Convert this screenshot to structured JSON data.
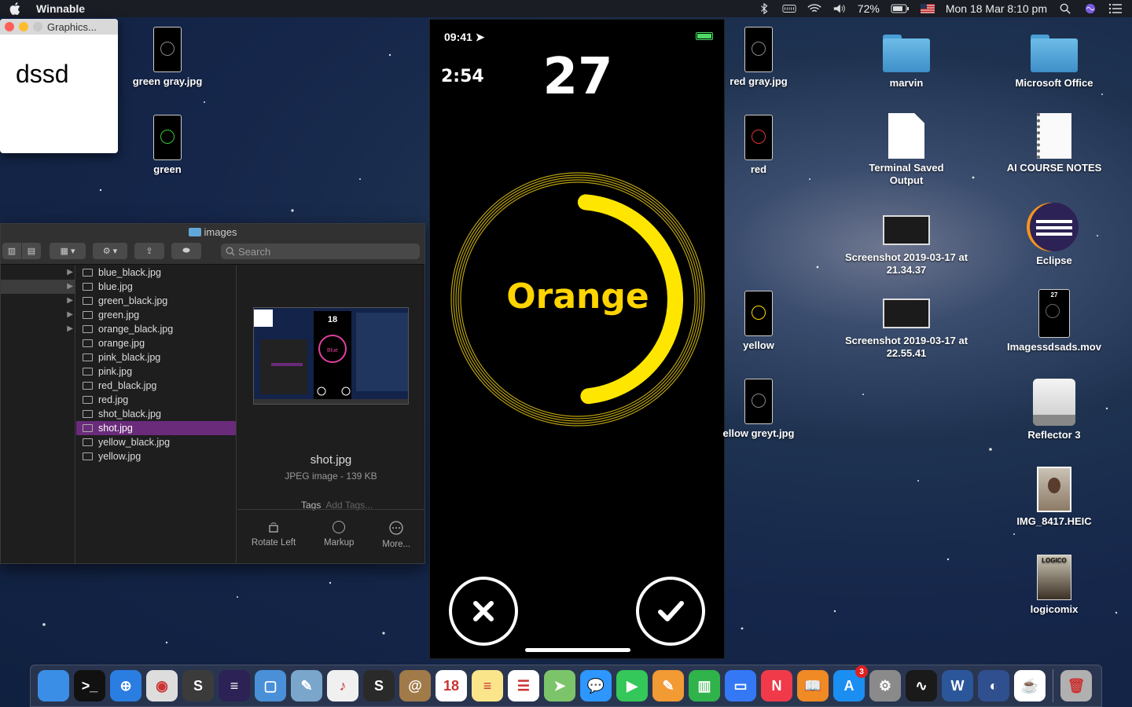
{
  "menubar": {
    "app_name": "Winnable",
    "battery_percent": "72%",
    "datetime": "Mon 18 Mar  8:10 pm"
  },
  "graphics_window": {
    "title": "Graphics...",
    "content_text": "dssd"
  },
  "finder": {
    "title": "images",
    "search_placeholder": "Search",
    "files": [
      {
        "name": "blue_black.jpg",
        "selected": false
      },
      {
        "name": "blue.jpg",
        "selected": false
      },
      {
        "name": "green_black.jpg",
        "selected": false
      },
      {
        "name": "green.jpg",
        "selected": false
      },
      {
        "name": "orange_black.jpg",
        "selected": false
      },
      {
        "name": "orange.jpg",
        "selected": false
      },
      {
        "name": "pink_black.jpg",
        "selected": false
      },
      {
        "name": "pink.jpg",
        "selected": false
      },
      {
        "name": "red_black.jpg",
        "selected": false
      },
      {
        "name": "red.jpg",
        "selected": false
      },
      {
        "name": "shot_black.jpg",
        "selected": false
      },
      {
        "name": "shot.jpg",
        "selected": true
      },
      {
        "name": "yellow_black.jpg",
        "selected": false
      },
      {
        "name": "yellow.jpg",
        "selected": false
      }
    ],
    "preview": {
      "file_name": "shot.jpg",
      "file_info": "JPEG image - 139 KB",
      "tags_label": "Tags",
      "tags_placeholder": "Add Tags...",
      "actions": {
        "rotate": "Rotate Left",
        "markup": "Markup",
        "more": "More..."
      },
      "thumb_score": "18",
      "thumb_word": "Blue"
    }
  },
  "phone": {
    "clock": "09:41",
    "timer": "2:54",
    "score": "27",
    "word": "Orange",
    "word_color": "#ffd400",
    "ring_progress": 0.47,
    "ring_color": "#ffe600"
  },
  "desktop": {
    "col_left": [
      {
        "label": "green gray.jpg",
        "ring": "#888"
      },
      {
        "label": "green",
        "ring": "#3c3"
      }
    ],
    "col_mid": [
      {
        "label": "red gray.jpg",
        "ring": "#888"
      },
      {
        "label": "red",
        "ring": "#d33"
      },
      {
        "label": "yellow",
        "ring": "#fd0"
      },
      {
        "label": "ellow greyt.jpg",
        "ring": "#888"
      }
    ],
    "col_c": {
      "marvin": "marvin",
      "terminal": "Terminal Saved Output",
      "ss1": "Screenshot 2019-03-17 at 21.34.37",
      "ss2": "Screenshot 2019-03-17 at 22.55.41"
    },
    "col_d": {
      "office": "Microsoft Office",
      "ai": "AI COURSE NOTES",
      "eclipse": "Eclipse",
      "mov": "Imagessdsads.mov",
      "reflector": "Reflector 3",
      "img": "IMG_8417.HEIC",
      "logicomix": "logicomix",
      "mov_score": "27",
      "book_title": "LOGICO"
    }
  },
  "dock": {
    "apps": [
      {
        "name": "finder",
        "color": "#3a8ee6",
        "glyph": ""
      },
      {
        "name": "terminal",
        "color": "#111",
        "glyph": ">_"
      },
      {
        "name": "safari",
        "color": "#2a7de1",
        "glyph": "⊕"
      },
      {
        "name": "chrome",
        "color": "#ddd",
        "glyph": "◉"
      },
      {
        "name": "sublime",
        "color": "#3b3b3b",
        "glyph": "S"
      },
      {
        "name": "eclipse",
        "color": "#2c2255",
        "glyph": "≡"
      },
      {
        "name": "simulator",
        "color": "#4a90d9",
        "glyph": "▢"
      },
      {
        "name": "preview",
        "color": "#7aa6cc",
        "glyph": "✎"
      },
      {
        "name": "itunes",
        "color": "#f0f0f0",
        "glyph": "♪"
      },
      {
        "name": "scrivener",
        "color": "#2a2a2a",
        "glyph": "S"
      },
      {
        "name": "contacts",
        "color": "#a07a48",
        "glyph": "@"
      },
      {
        "name": "calendar",
        "color": "#fff",
        "glyph": "18"
      },
      {
        "name": "notes",
        "color": "#fbe58a",
        "glyph": "≡"
      },
      {
        "name": "reminders",
        "color": "#fff",
        "glyph": "☰"
      },
      {
        "name": "maps",
        "color": "#7cc46a",
        "glyph": "➤"
      },
      {
        "name": "messages",
        "color": "#2d97ff",
        "glyph": "💬"
      },
      {
        "name": "facetime",
        "color": "#34c759",
        "glyph": "▶"
      },
      {
        "name": "pages",
        "color": "#f29a34",
        "glyph": "✎"
      },
      {
        "name": "numbers",
        "color": "#2fb34a",
        "glyph": "▥"
      },
      {
        "name": "keynote",
        "color": "#3478f6",
        "glyph": "▭"
      },
      {
        "name": "news",
        "color": "#f03a4a",
        "glyph": "N"
      },
      {
        "name": "books",
        "color": "#f08a24",
        "glyph": "📖"
      },
      {
        "name": "appstore",
        "color": "#1b8ef2",
        "glyph": "A",
        "badge": "3"
      },
      {
        "name": "system-preferences",
        "color": "#8a8a8a",
        "glyph": "⚙"
      },
      {
        "name": "activity-monitor",
        "color": "#1a1a1a",
        "glyph": "∿"
      },
      {
        "name": "word",
        "color": "#2b579a",
        "glyph": "W"
      },
      {
        "name": "camino",
        "color": "#2f4f8f",
        "glyph": "◐"
      },
      {
        "name": "java",
        "color": "#fff",
        "glyph": "☕"
      },
      {
        "name": "trash",
        "color": "#b0b0b0",
        "glyph": "🗑"
      }
    ]
  }
}
